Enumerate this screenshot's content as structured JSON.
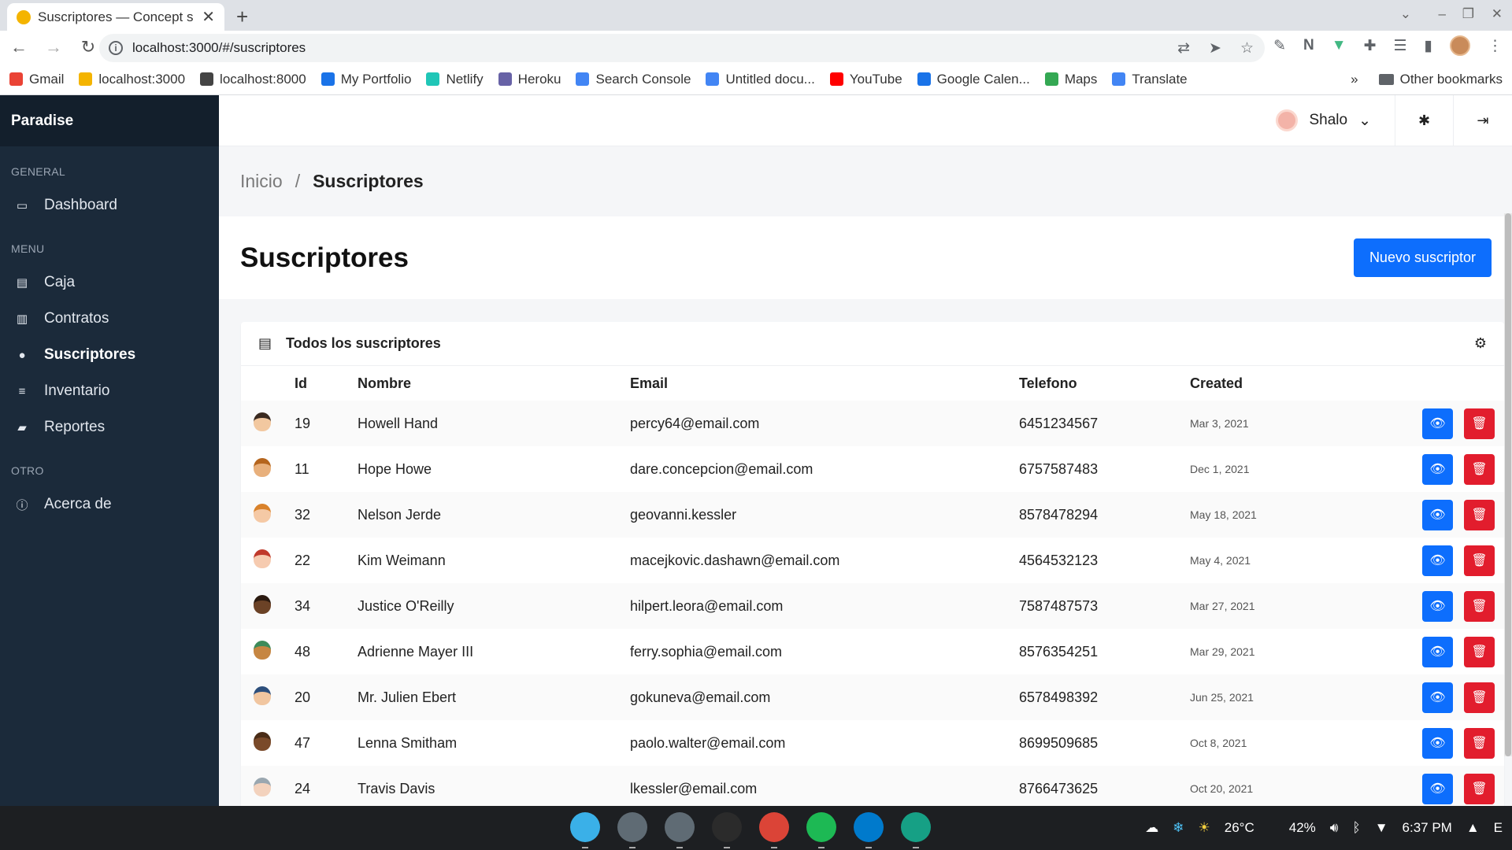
{
  "browser": {
    "tab_title": "Suscriptores — Concept s",
    "url": "localhost:3000/#/suscriptores",
    "bookmarks": [
      {
        "label": "Gmail",
        "color": "#ea4335"
      },
      {
        "label": "localhost:3000",
        "color": "#f4b400"
      },
      {
        "label": "localhost:8000",
        "color": "#444444"
      },
      {
        "label": "My Portfolio",
        "color": "#1a73e8"
      },
      {
        "label": "Netlify",
        "color": "#20c6b7"
      },
      {
        "label": "Heroku",
        "color": "#6762a6"
      },
      {
        "label": "Search Console",
        "color": "#4285f4"
      },
      {
        "label": "Untitled docu...",
        "color": "#4285f4"
      },
      {
        "label": "YouTube",
        "color": "#ff0000"
      },
      {
        "label": "Google Calen...",
        "color": "#1a73e8"
      },
      {
        "label": "Maps",
        "color": "#34a853"
      },
      {
        "label": "Translate",
        "color": "#4285f4"
      }
    ],
    "more_bookmarks": "»",
    "other_bookmarks": "Other bookmarks"
  },
  "sidebar": {
    "brand": "Paradise",
    "sections": [
      {
        "label": "GENERAL",
        "items": [
          {
            "label": "Dashboard",
            "icon": "monitor-icon",
            "glyph": "▭",
            "active": false
          }
        ]
      },
      {
        "label": "MENU",
        "items": [
          {
            "label": "Caja",
            "icon": "cash-register-icon",
            "glyph": "▤",
            "active": false
          },
          {
            "label": "Contratos",
            "icon": "file-contract-icon",
            "glyph": "▥",
            "active": false
          },
          {
            "label": "Suscriptores",
            "icon": "user-circle-icon",
            "glyph": "●",
            "active": true
          },
          {
            "label": "Inventario",
            "icon": "database-icon",
            "glyph": "≡",
            "active": false
          },
          {
            "label": "Reportes",
            "icon": "chart-icon",
            "glyph": "▰",
            "active": false
          }
        ]
      },
      {
        "label": "OTRO",
        "items": [
          {
            "label": "Acerca de",
            "icon": "info-icon",
            "glyph": "ⓘ",
            "active": false
          }
        ]
      }
    ]
  },
  "topbar": {
    "user_name": "Shalo"
  },
  "breadcrumb": {
    "home": "Inicio",
    "separator": "/",
    "current": "Suscriptores"
  },
  "page": {
    "title": "Suscriptores",
    "new_button": "Nuevo suscriptor"
  },
  "card": {
    "title": "Todos los suscriptores",
    "columns": {
      "id": "Id",
      "name": "Nombre",
      "email": "Email",
      "phone": "Telefono",
      "created": "Created"
    },
    "rows": [
      {
        "id": "19",
        "name": "Howell Hand",
        "email": "percy64@email.com",
        "phone": "6451234567",
        "created": "Mar 3, 2021",
        "skin": "#f2c8a0",
        "hair": "#3a2a20"
      },
      {
        "id": "11",
        "name": "Hope Howe",
        "email": "dare.concepcion@email.com",
        "phone": "6757587483",
        "created": "Dec 1, 2021",
        "skin": "#e8b07c",
        "hair": "#b5651d"
      },
      {
        "id": "32",
        "name": "Nelson Jerde",
        "email": "geovanni.kessler",
        "phone": "8578478294",
        "created": "May 18, 2021",
        "skin": "#f5c9a5",
        "hair": "#d9822b"
      },
      {
        "id": "22",
        "name": "Kim Weimann",
        "email": "macejkovic.dashawn@email.com",
        "phone": "4564532123",
        "created": "May 4, 2021",
        "skin": "#f6cbb0",
        "hair": "#c0392b"
      },
      {
        "id": "34",
        "name": "Justice O'Reilly",
        "email": "hilpert.leora@email.com",
        "phone": "7587487573",
        "created": "Mar 27, 2021",
        "skin": "#6b4226",
        "hair": "#2b1a10"
      },
      {
        "id": "48",
        "name": "Adrienne Mayer III",
        "email": "ferry.sophia@email.com",
        "phone": "8576354251",
        "created": "Mar 29, 2021",
        "skin": "#c68642",
        "hair": "#3d8b5a"
      },
      {
        "id": "20",
        "name": "Mr. Julien Ebert",
        "email": "gokuneva@email.com",
        "phone": "6578498392",
        "created": "Jun 25, 2021",
        "skin": "#f1c6a0",
        "hair": "#2d4f7c"
      },
      {
        "id": "47",
        "name": "Lenna Smitham",
        "email": "paolo.walter@email.com",
        "phone": "8699509685",
        "created": "Oct 8, 2021",
        "skin": "#7a4a2a",
        "hair": "#4a2c17"
      },
      {
        "id": "24",
        "name": "Travis Davis",
        "email": "lkessler@email.com",
        "phone": "8766473625",
        "created": "Oct 20, 2021",
        "skin": "#f3d2bd",
        "hair": "#9aa7b0"
      }
    ]
  },
  "taskbar": {
    "apps": [
      {
        "name": "linux-icon",
        "color": "#3ab0e8"
      },
      {
        "name": "files-icon",
        "color": "#5f6b74"
      },
      {
        "name": "store-icon",
        "color": "#5f6b74"
      },
      {
        "name": "terminal-icon",
        "color": "#2b2b2b"
      },
      {
        "name": "chrome-icon",
        "color": "#db4437"
      },
      {
        "name": "spotify-icon",
        "color": "#1db954"
      },
      {
        "name": "vscode-icon",
        "color": "#007acc"
      },
      {
        "name": "camera-icon",
        "color": "#16a085"
      }
    ],
    "temperature": "26°C",
    "battery": "42%",
    "time": "6:37 PM"
  }
}
